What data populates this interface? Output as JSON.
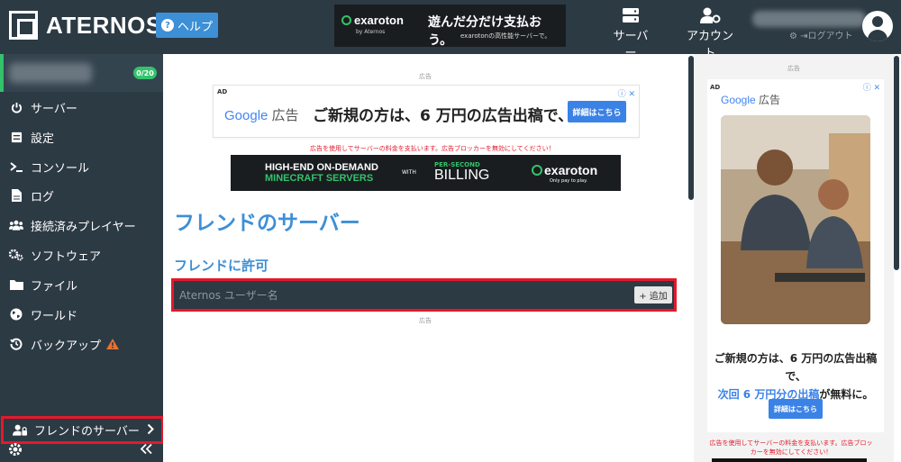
{
  "header": {
    "brand": "ATERNOS",
    "help_label": "ヘルプ",
    "nav": {
      "servers_label": "サーバー",
      "account_label": "アカウント",
      "logout_label": "ログアウト"
    }
  },
  "top_ad": {
    "brand": "exaroton",
    "brand_sub": "by Aternos",
    "headline": "遊んだ分だけ支払おう。",
    "subline": "exarotonの高性能サーバーで。"
  },
  "sidebar": {
    "server_badge": "0/20",
    "items": [
      {
        "label": "サーバー",
        "icon": "power-icon"
      },
      {
        "label": "設定",
        "icon": "sliders-icon"
      },
      {
        "label": "コンソール",
        "icon": "terminal-icon"
      },
      {
        "label": "ログ",
        "icon": "file-icon"
      },
      {
        "label": "接続済みプレイヤー",
        "icon": "users-icon"
      },
      {
        "label": "ソフトウェア",
        "icon": "gears-icon"
      },
      {
        "label": "ファイル",
        "icon": "folder-icon"
      },
      {
        "label": "ワールド",
        "icon": "globe-icon"
      },
      {
        "label": "バックアップ",
        "icon": "history-icon"
      },
      {
        "label": "フレンドのサーバー",
        "icon": "user-lock-icon"
      }
    ]
  },
  "main": {
    "ad_label": "広告",
    "google_ad": {
      "ad_tag": "AD",
      "google": "Google",
      "kokoku": "広告",
      "text": "ご新規の方は、6 万円の広告出稿で、...",
      "button": "詳細はこちら"
    },
    "adblock_note": "広告を使用してサーバーの料金を支払います。広告ブロッカーを無効にしてください！",
    "banner": {
      "line1": "HIGH-END ON-DEMAND",
      "line2": "MINECRAFT SERVERS",
      "with": "WITH",
      "per_second": "PER-SECOND",
      "billing": "BILLING",
      "brand": "exaroton",
      "tagline": "Only pay to play."
    },
    "page_title": "フレンドのサーバー",
    "section_title": "フレンドに許可",
    "input_placeholder": "Aternos ユーザー名",
    "add_button": "+ 追加",
    "ad_label_bottom": "広告"
  },
  "right_ad": {
    "ad_label": "広告",
    "ad_tag": "AD",
    "google": "Google",
    "kokoku": "広告",
    "line1": "ご新規の方は、6 万円の広告出稿で、",
    "line2_blue": "次回 6 万円分の出稿",
    "line2_rest": "が無料に。",
    "button": "詳細はこちら",
    "note": "広告を使用してサーバーの料金を支払います。広告ブロッカーを無効にしてください！"
  }
}
